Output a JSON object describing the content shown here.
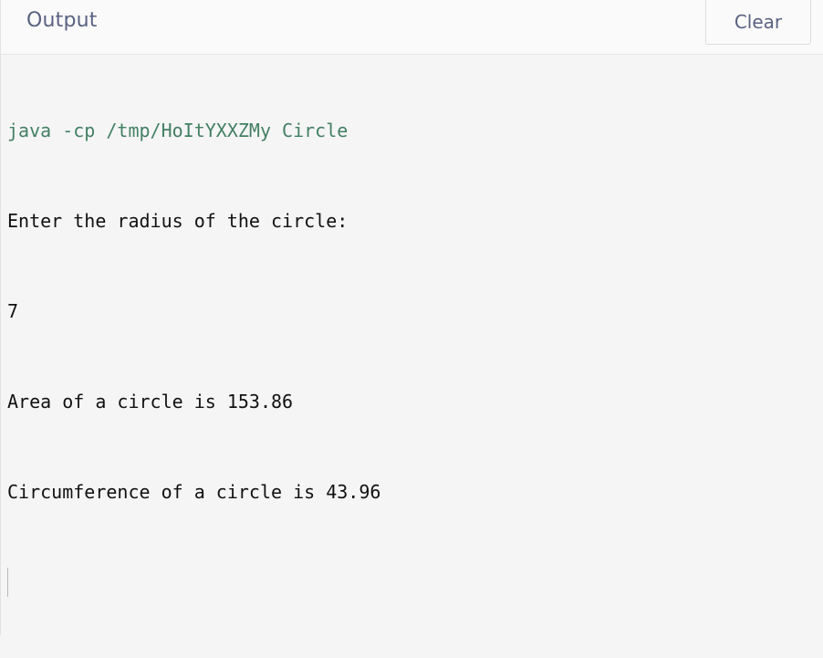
{
  "header": {
    "title": "Output",
    "clear_label": "Clear"
  },
  "console": {
    "command": "java -cp /tmp/HoItYXXZMy Circle",
    "lines": [
      "Enter the radius of the circle:",
      "7",
      "Area of a circle is 153.86",
      "Circumference of a circle is 43.96"
    ]
  },
  "colors": {
    "command_text": "#438064",
    "output_text": "#111111",
    "header_text": "#5a6282",
    "background": "#f5f5f5"
  }
}
